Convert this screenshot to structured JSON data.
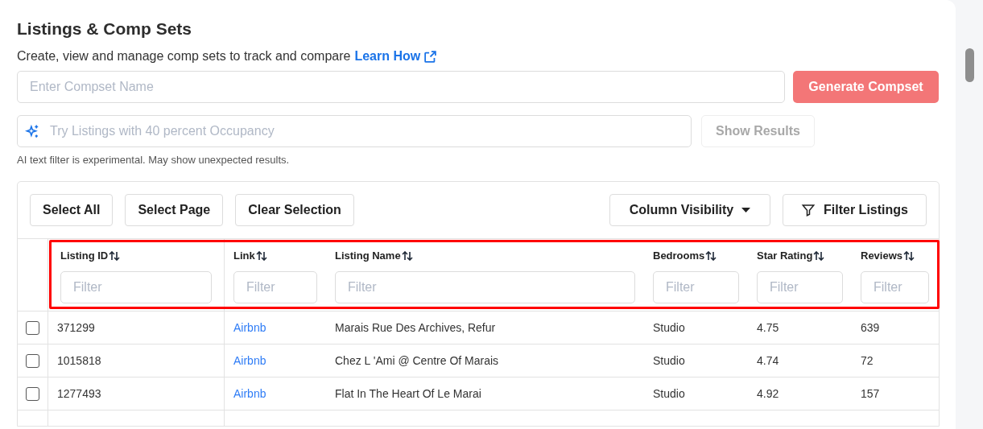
{
  "title": "Listings & Comp Sets",
  "subtitle": "Create, view and manage comp sets to track and compare",
  "learn_link": "Learn How",
  "compset_field": {
    "placeholder": "Enter Compset Name"
  },
  "generate_button": {
    "label": "Generate Compset"
  },
  "ai_field": {
    "placeholder": "Try Listings with 40 percent Occupancy"
  },
  "show_results_button": {
    "label": "Show Results",
    "disabled": true
  },
  "ai_note": "AI text filter is experimental. May show unexpected results.",
  "toolbar": {
    "left": [
      "Select All",
      "Select Page",
      "Clear Selection"
    ],
    "column_visibility": "Column Visibility",
    "filter_listings": "Filter Listings"
  },
  "table": {
    "header_highlighted": true,
    "columns": [
      {
        "label": "Listing ID",
        "filter_placeholder": "Filter"
      },
      {
        "label": "Link",
        "filter_placeholder": "Filter"
      },
      {
        "label": "Listing Name",
        "filter_placeholder": "Filter"
      },
      {
        "label": "Bedrooms",
        "filter_placeholder": "Filter"
      },
      {
        "label": "Star Rating",
        "filter_placeholder": "Filter"
      },
      {
        "label": "Reviews",
        "filter_placeholder": "Filter"
      }
    ],
    "rows": [
      {
        "checked": false,
        "cells": [
          "371299",
          "Airbnb",
          "Marais Rue Des Archives, Refur",
          "Studio",
          "4.75",
          "639"
        ]
      },
      {
        "checked": false,
        "cells": [
          "1015818",
          "Airbnb",
          "Chez L 'Ami @ Centre Of Marais",
          "Studio",
          "4.74",
          "72"
        ]
      },
      {
        "checked": false,
        "cells": [
          "1277493",
          "Airbnb",
          "Flat In The Heart Of Le Marai",
          "Studio",
          "4.92",
          "157"
        ]
      }
    ]
  }
}
